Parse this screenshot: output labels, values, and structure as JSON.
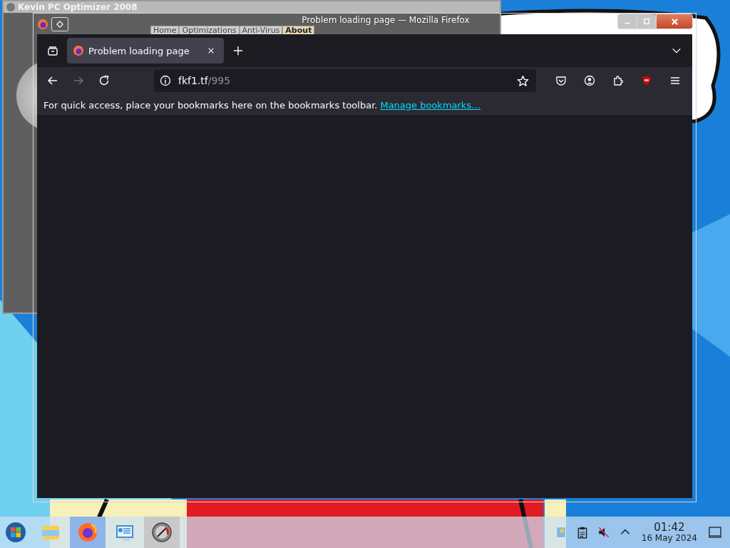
{
  "background_window": {
    "title": "Kevin PC Optimizer 2008",
    "tabs": [
      {
        "label": "Home",
        "selected": false
      },
      {
        "label": "Optimizations",
        "selected": false
      },
      {
        "label": "Anti-Virus",
        "selected": false
      },
      {
        "label": "About",
        "selected": true
      }
    ]
  },
  "window": {
    "title": "Problem loading page — Mozilla Firefox"
  },
  "tabs": [
    {
      "label": "Problem loading page",
      "selected": true
    }
  ],
  "navigation": {
    "back_disabled": false,
    "forward_disabled": true
  },
  "address_bar": {
    "host": "fkf1.tf",
    "path": "/995"
  },
  "bookmarks_bar": {
    "message": "For quick access, place your bookmarks here on the bookmarks toolbar.",
    "link": "Manage bookmarks…"
  },
  "taskbar": {
    "apps": [
      {
        "kind": "files",
        "selected": false,
        "running": false
      },
      {
        "kind": "firefox",
        "selected": true,
        "running": true
      },
      {
        "kind": "settings",
        "selected": false,
        "running": false
      },
      {
        "kind": "optimizer",
        "selected": false,
        "running": true
      }
    ],
    "tray": {
      "muted": true
    },
    "clock": {
      "time": "01:42",
      "date": "16 May 2024"
    }
  }
}
